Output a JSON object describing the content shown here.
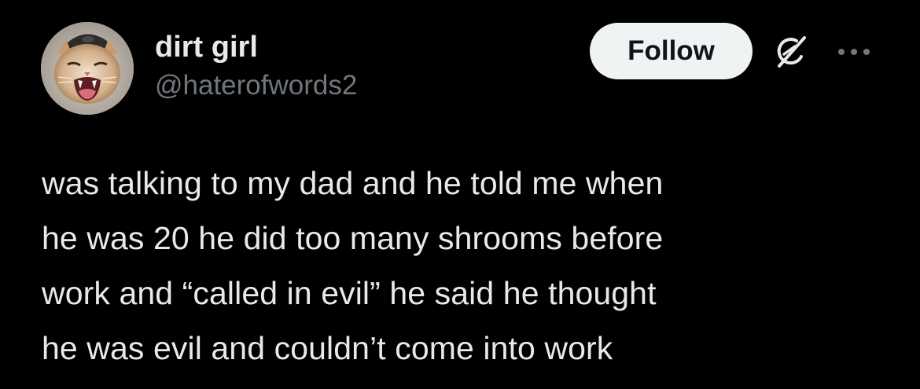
{
  "colors": {
    "background": "#000000",
    "text_primary": "#e7e9ea",
    "text_secondary": "#71767b",
    "follow_bg": "#eff3f4",
    "follow_text": "#0f1419"
  },
  "author": {
    "display_name": "dirt girl",
    "handle": "@haterofwords2",
    "avatar_icon": "cat-avatar"
  },
  "actions": {
    "follow_label": "Follow",
    "grok_icon": "grok-icon",
    "more_icon": "more-options-icon"
  },
  "tweet": {
    "lines": [
      "was talking to my dad and he told me when",
      "he was 20 he did too many shrooms before",
      "work and “called in evil” he said he thought",
      "he was evil and couldn’t come into work"
    ]
  }
}
